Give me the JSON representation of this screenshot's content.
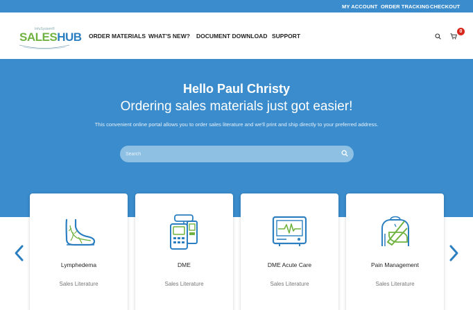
{
  "topbar": {
    "my_account": "MY ACCOUNT",
    "order_tracking": "ORDER TRACKING",
    "checkout": "CHECKOUT"
  },
  "logo": {
    "small": "InfuSystem®",
    "sales": "SALES",
    "hub": "HUB"
  },
  "nav": {
    "order_materials": "ORDER MATERIALS",
    "whats_new": "WHAT'S NEW?",
    "document_download": "DOCUMENT DOWNLOAD",
    "support": "SUPPORT"
  },
  "cart": {
    "count": "0"
  },
  "hero": {
    "title": "Hello Paul Christy",
    "subtitle": "Ordering sales materials just got easier!",
    "description": "This convenient online portal allows you to order sales literature and we'll print and ship directly to your preferred address.",
    "search_placeholder": "Search"
  },
  "cards": [
    {
      "title": "Lymphedema",
      "subtitle": "Sales Literature",
      "icon": "foot-icon"
    },
    {
      "title": "DME",
      "subtitle": "Sales Literature",
      "icon": "infusion-pump-icon"
    },
    {
      "title": "DME Acute Care",
      "subtitle": "Sales Literature",
      "icon": "monitor-icon"
    },
    {
      "title": "Pain Management",
      "subtitle": "Sales Literature",
      "icon": "arm-sling-icon"
    }
  ],
  "colors": {
    "brand_blue": "#3a8ccc",
    "brand_green": "#6fb23f",
    "icon_blue": "#2b7fc0",
    "badge_red": "#d9261c"
  }
}
